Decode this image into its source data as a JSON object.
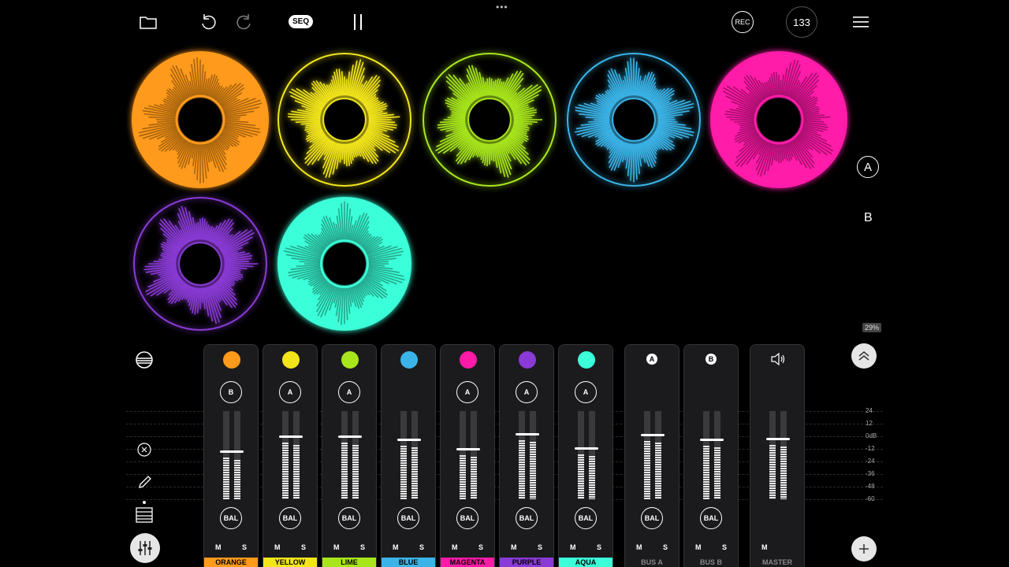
{
  "toolbar": {
    "seq_label": "SEQ",
    "rec_label": "REC",
    "tempo": "133",
    "more": "•••"
  },
  "side": {
    "a_label": "A",
    "b_label": "B",
    "percent": "29%"
  },
  "loops": [
    {
      "name": "orange",
      "color": "#ff9a1a"
    },
    {
      "name": "yellow",
      "color": "#f2e51a"
    },
    {
      "name": "lime",
      "color": "#a8e61c"
    },
    {
      "name": "blue",
      "color": "#3ab4e8"
    },
    {
      "name": "magenta",
      "color": "#ff1aa8"
    },
    {
      "name": "purple",
      "color": "#8a3ad6"
    },
    {
      "name": "aqua",
      "color": "#3affd8"
    }
  ],
  "channels": [
    {
      "name": "ORANGE",
      "color": "#ff9a1a",
      "send": "B",
      "bal": "BAL",
      "m": "M",
      "s": "S",
      "level": 0.55
    },
    {
      "name": "YELLOW",
      "color": "#f2e51a",
      "send": "A",
      "bal": "BAL",
      "m": "M",
      "s": "S",
      "level": 0.72
    },
    {
      "name": "LIME",
      "color": "#a8e61c",
      "send": "A",
      "bal": "BAL",
      "m": "M",
      "s": "S",
      "level": 0.72
    },
    {
      "name": "BLUE",
      "color": "#3ab4e8",
      "send": "",
      "bal": "BAL",
      "m": "M",
      "s": "S",
      "level": 0.69
    },
    {
      "name": "MAGENTA",
      "color": "#ff1aa8",
      "send": "A",
      "bal": "BAL",
      "m": "M",
      "s": "S",
      "level": 0.58
    },
    {
      "name": "PURPLE",
      "color": "#8a3ad6",
      "send": "A",
      "bal": "BAL",
      "m": "M",
      "s": "S",
      "level": 0.75
    },
    {
      "name": "AQUA",
      "color": "#3affd8",
      "send": "A",
      "bal": "BAL",
      "m": "M",
      "s": "S",
      "level": 0.59
    }
  ],
  "buses": [
    {
      "name": "BUS A",
      "badge": "A",
      "bal": "BAL",
      "m": "M",
      "s": "S",
      "level": 0.74
    },
    {
      "name": "BUS B",
      "badge": "B",
      "bal": "BAL",
      "m": "M",
      "s": "S",
      "level": 0.69
    },
    {
      "name": "MASTER",
      "badge": "",
      "bal": "",
      "m": "M",
      "s": "",
      "level": 0.7
    }
  ],
  "scale": [
    "24",
    "12",
    "0dB",
    "-12",
    "-24",
    "-36",
    "-48",
    "-60"
  ]
}
